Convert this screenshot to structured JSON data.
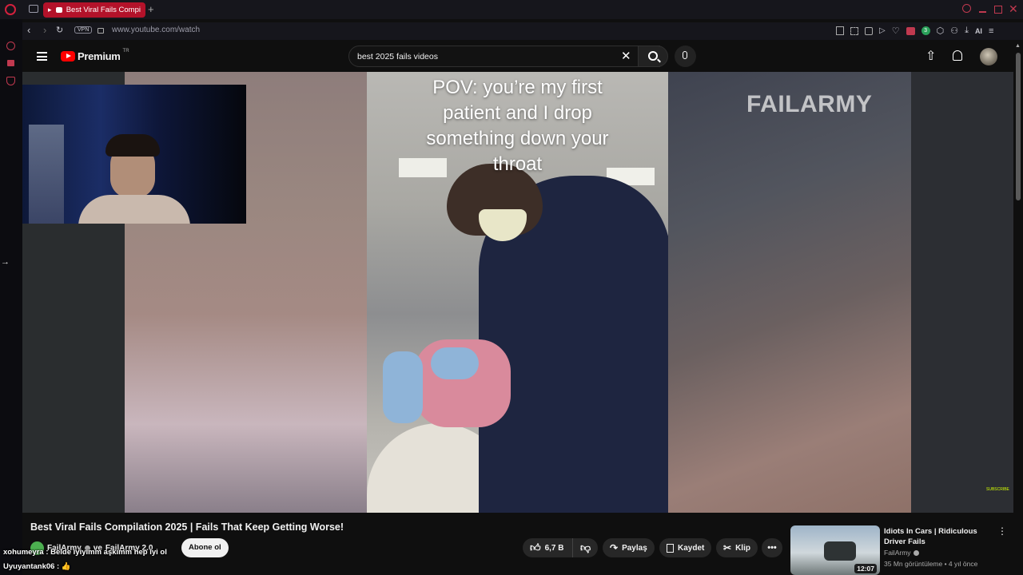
{
  "browser": {
    "tab_title": "Best Viral Fails Compi",
    "url": "www.youtube.com/watch",
    "vpn_label": "VPN",
    "ext_badge": "3",
    "ai_label": "AI"
  },
  "youtube": {
    "logo_text": "Premium",
    "region": "TR",
    "search_query": "best 2025 fails videos"
  },
  "video": {
    "caption": "POV: you’re my first patient and I drop something down your throat",
    "watermark": "FAILARMY",
    "subscribe_mark": "SUBSCRIBE",
    "title": "Best Viral Fails Compilation 2025 | Fails That Keep Getting Worse!",
    "channel": "FailArmy",
    "channel_and": "ve",
    "channel2": "FailArmy 2.0",
    "subscribe_label": "Abone ol",
    "likes": "6,7 B",
    "share": "Paylaş",
    "save": "Kaydet",
    "clip": "Klip"
  },
  "chat": [
    {
      "user": "xohumeyra",
      "msg": "Belde iyiyimm aşkımm hep iyi ol"
    },
    {
      "user": "Uyuyantank06",
      "msg": "👍"
    }
  ],
  "recommended": {
    "title": "Idiots In Cars | Ridiculous Driver Fails",
    "channel": "FailArmy",
    "meta": "35 Mn görüntüleme • 4 yıl önce",
    "duration": "12:07"
  },
  "colors": {
    "accent_red": "#b3122a",
    "yt_red": "#ff0000",
    "scrub": "#ff0000"
  }
}
